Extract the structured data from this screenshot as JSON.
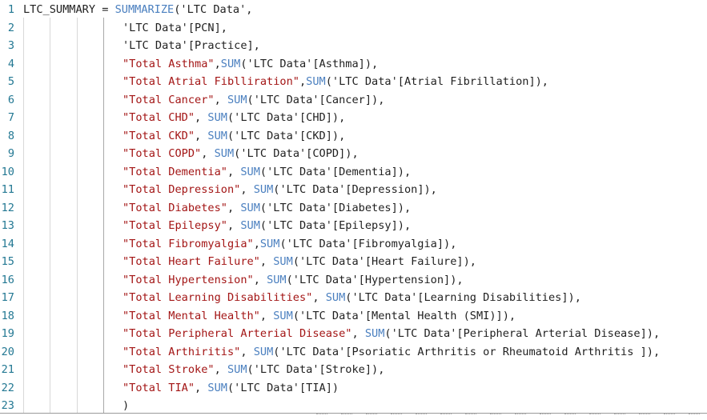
{
  "editor": {
    "lines": [
      {
        "n": "1",
        "parts": [
          {
            "t": "LTC_SUMMARY = ",
            "c": "txt"
          },
          {
            "t": "SUMMARIZE",
            "c": "fn"
          },
          {
            "t": "('LTC Data',",
            "c": "txt"
          }
        ]
      },
      {
        "n": "2",
        "parts": [
          {
            "t": "'LTC Data'[PCN],",
            "c": "txt"
          }
        ]
      },
      {
        "n": "3",
        "parts": [
          {
            "t": "'LTC Data'[Practice],",
            "c": "txt"
          }
        ]
      },
      {
        "n": "4",
        "parts": [
          {
            "t": "\"Total Asthma\"",
            "c": "str"
          },
          {
            "t": ",",
            "c": "txt"
          },
          {
            "t": "SUM",
            "c": "fn"
          },
          {
            "t": "('LTC Data'[Asthma]),",
            "c": "txt"
          }
        ]
      },
      {
        "n": "5",
        "parts": [
          {
            "t": "\"Total Atrial Fiblliration\"",
            "c": "str"
          },
          {
            "t": ",",
            "c": "txt"
          },
          {
            "t": "SUM",
            "c": "fn"
          },
          {
            "t": "('LTC Data'[Atrial Fibrillation]),",
            "c": "txt"
          }
        ]
      },
      {
        "n": "6",
        "parts": [
          {
            "t": "\"Total Cancer\"",
            "c": "str"
          },
          {
            "t": ", ",
            "c": "txt"
          },
          {
            "t": "SUM",
            "c": "fn"
          },
          {
            "t": "('LTC Data'[Cancer]),",
            "c": "txt"
          }
        ]
      },
      {
        "n": "7",
        "parts": [
          {
            "t": "\"Total CHD\"",
            "c": "str"
          },
          {
            "t": ", ",
            "c": "txt"
          },
          {
            "t": "SUM",
            "c": "fn"
          },
          {
            "t": "('LTC Data'[CHD]),",
            "c": "txt"
          }
        ]
      },
      {
        "n": "8",
        "parts": [
          {
            "t": "\"Total CKD\"",
            "c": "str"
          },
          {
            "t": ", ",
            "c": "txt"
          },
          {
            "t": "SUM",
            "c": "fn"
          },
          {
            "t": "('LTC Data'[CKD]),",
            "c": "txt"
          }
        ]
      },
      {
        "n": "9",
        "parts": [
          {
            "t": "\"Total COPD\"",
            "c": "str"
          },
          {
            "t": ", ",
            "c": "txt"
          },
          {
            "t": "SUM",
            "c": "fn"
          },
          {
            "t": "('LTC Data'[COPD]),",
            "c": "txt"
          }
        ]
      },
      {
        "n": "10",
        "parts": [
          {
            "t": "\"Total Dementia\"",
            "c": "str"
          },
          {
            "t": ", ",
            "c": "txt"
          },
          {
            "t": "SUM",
            "c": "fn"
          },
          {
            "t": "('LTC Data'[Dementia]),",
            "c": "txt"
          }
        ]
      },
      {
        "n": "11",
        "parts": [
          {
            "t": "\"Total Depression\"",
            "c": "str"
          },
          {
            "t": ", ",
            "c": "txt"
          },
          {
            "t": "SUM",
            "c": "fn"
          },
          {
            "t": "('LTC Data'[Depression]),",
            "c": "txt"
          }
        ]
      },
      {
        "n": "12",
        "parts": [
          {
            "t": "\"Total Diabetes\"",
            "c": "str"
          },
          {
            "t": ", ",
            "c": "txt"
          },
          {
            "t": "SUM",
            "c": "fn"
          },
          {
            "t": "('LTC Data'[Diabetes]),",
            "c": "txt"
          }
        ]
      },
      {
        "n": "13",
        "parts": [
          {
            "t": "\"Total Epilepsy\"",
            "c": "str"
          },
          {
            "t": ", ",
            "c": "txt"
          },
          {
            "t": "SUM",
            "c": "fn"
          },
          {
            "t": "('LTC Data'[Epilepsy]),",
            "c": "txt"
          }
        ]
      },
      {
        "n": "14",
        "parts": [
          {
            "t": "\"Total Fibromyalgia\"",
            "c": "str"
          },
          {
            "t": ",",
            "c": "txt"
          },
          {
            "t": "SUM",
            "c": "fn"
          },
          {
            "t": "('LTC Data'[Fibromyalgia]),",
            "c": "txt"
          }
        ]
      },
      {
        "n": "15",
        "parts": [
          {
            "t": "\"Total Heart Failure\"",
            "c": "str"
          },
          {
            "t": ", ",
            "c": "txt"
          },
          {
            "t": "SUM",
            "c": "fn"
          },
          {
            "t": "('LTC Data'[Heart Failure]),",
            "c": "txt"
          }
        ]
      },
      {
        "n": "16",
        "parts": [
          {
            "t": "\"Total Hypertension\"",
            "c": "str"
          },
          {
            "t": ", ",
            "c": "txt"
          },
          {
            "t": "SUM",
            "c": "fn"
          },
          {
            "t": "('LTC Data'[Hypertension]),",
            "c": "txt"
          }
        ]
      },
      {
        "n": "17",
        "parts": [
          {
            "t": "\"Total Learning Disabilities\"",
            "c": "str"
          },
          {
            "t": ", ",
            "c": "txt"
          },
          {
            "t": "SUM",
            "c": "fn"
          },
          {
            "t": "('LTC Data'[Learning Disabilities]),",
            "c": "txt"
          }
        ]
      },
      {
        "n": "18",
        "parts": [
          {
            "t": "\"Total Mental Health\"",
            "c": "str"
          },
          {
            "t": ", ",
            "c": "txt"
          },
          {
            "t": "SUM",
            "c": "fn"
          },
          {
            "t": "('LTC Data'[Mental Health (SMI)]),",
            "c": "txt"
          }
        ]
      },
      {
        "n": "19",
        "parts": [
          {
            "t": "\"Total Peripheral Arterial Disease\"",
            "c": "str"
          },
          {
            "t": ", ",
            "c": "txt"
          },
          {
            "t": "SUM",
            "c": "fn"
          },
          {
            "t": "('LTC Data'[Peripheral Arterial Disease]),",
            "c": "txt"
          }
        ]
      },
      {
        "n": "20",
        "parts": [
          {
            "t": "\"Total Arthiritis\"",
            "c": "str"
          },
          {
            "t": ", ",
            "c": "txt"
          },
          {
            "t": "SUM",
            "c": "fn"
          },
          {
            "t": "('LTC Data'[Psoriatic Arthritis or Rheumatoid Arthritis ]),",
            "c": "txt"
          }
        ]
      },
      {
        "n": "21",
        "parts": [
          {
            "t": "\"Total Stroke\"",
            "c": "str"
          },
          {
            "t": ", ",
            "c": "txt"
          },
          {
            "t": "SUM",
            "c": "fn"
          },
          {
            "t": "('LTC Data'[Stroke]),",
            "c": "txt"
          }
        ]
      },
      {
        "n": "22",
        "parts": [
          {
            "t": "\"Total TIA\"",
            "c": "str"
          },
          {
            "t": ", ",
            "c": "txt"
          },
          {
            "t": "SUM",
            "c": "fn"
          },
          {
            "t": "('LTC Data'[TIA])",
            "c": "txt"
          }
        ]
      },
      {
        "n": "23",
        "parts": [
          {
            "t": ")",
            "c": "txt"
          }
        ]
      }
    ]
  },
  "colors": {
    "line_number": "#237893",
    "function": "#4a7fbf",
    "string": "#a31515",
    "text": "#1f1f1f"
  }
}
